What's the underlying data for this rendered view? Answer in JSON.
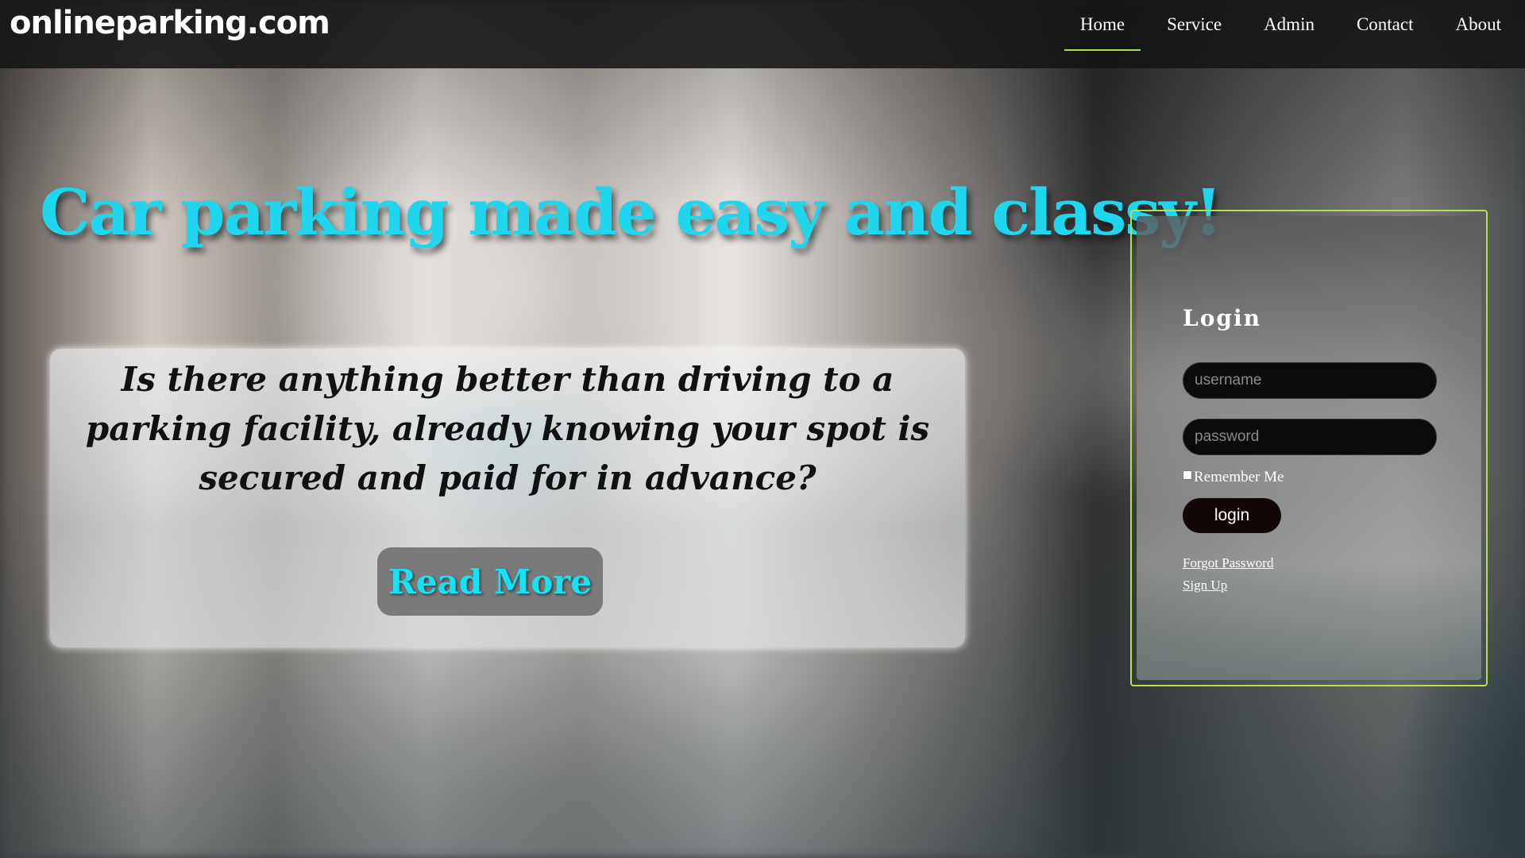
{
  "brand": {
    "logo": "onlineparking.com"
  },
  "nav": {
    "items": [
      {
        "label": "Home",
        "active": true
      },
      {
        "label": "Service",
        "active": false
      },
      {
        "label": "Admin",
        "active": false
      },
      {
        "label": "Contact",
        "active": false
      },
      {
        "label": "About",
        "active": false
      }
    ],
    "active_underline_color": "#a6e05b"
  },
  "hero": {
    "title": "Car parking made easy and classy!",
    "title_color": "#1fd6ee",
    "text": "Is there anything better than driving to a parking facility, already knowing your spot is secured and paid for in advance?",
    "read_more_label": "Read More"
  },
  "login": {
    "title": "Login",
    "username_placeholder": "username",
    "password_placeholder": "password",
    "remember_label": "Remember Me",
    "remember_checked": false,
    "submit_label": "login",
    "forgot_label": "Forgot Password",
    "signup_label": "Sign Up",
    "frame_color": "#b4e04a"
  }
}
